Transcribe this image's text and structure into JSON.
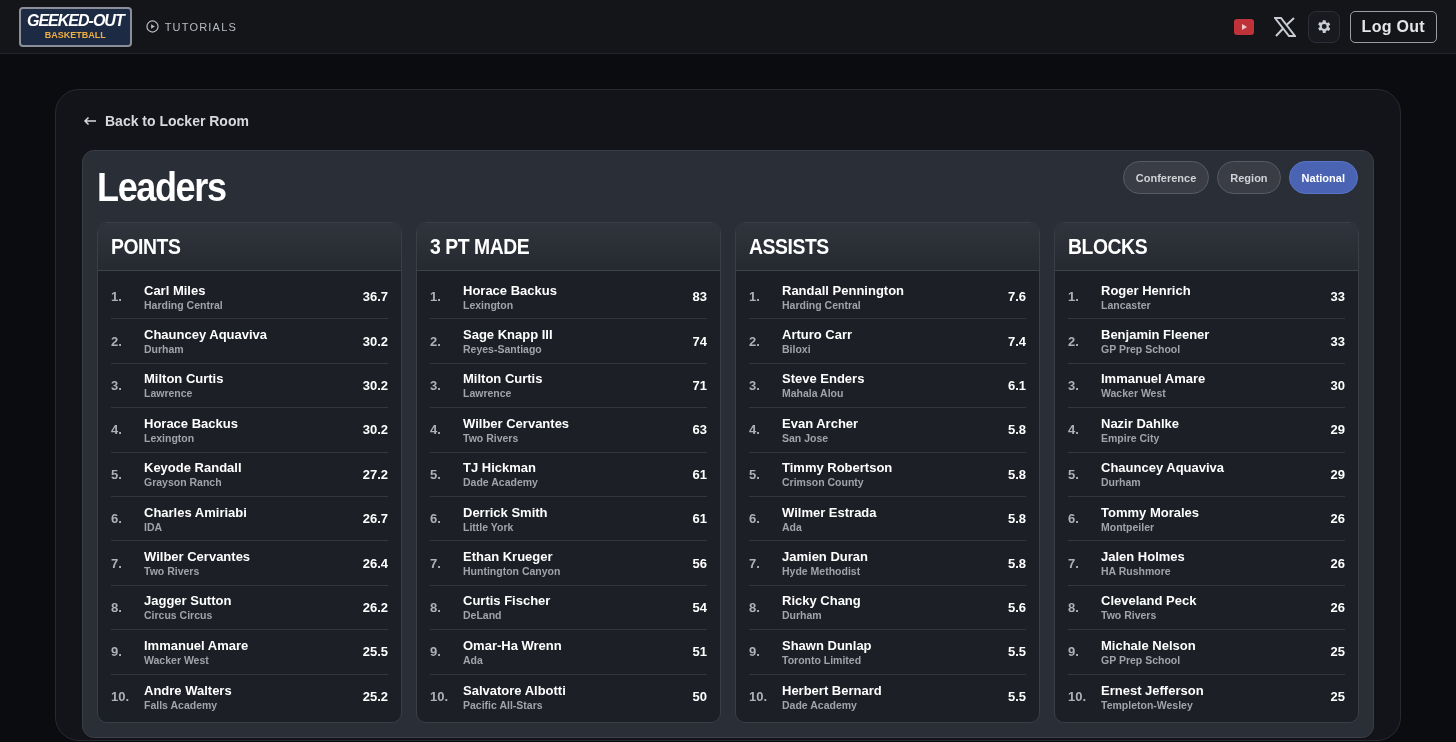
{
  "header": {
    "logo": {
      "title": "GEEKED-OUT",
      "subtitle": "BASKETBALL"
    },
    "tutorials": "TUTORIALS",
    "logout": "Log Out"
  },
  "back_link": "Back to Locker Room",
  "title": "Leaders",
  "scopes": [
    {
      "label": "Conference",
      "selected": false
    },
    {
      "label": "Region",
      "selected": false
    },
    {
      "label": "National",
      "selected": true
    }
  ],
  "categories": [
    {
      "title": "POINTS",
      "rows": [
        {
          "rank": "1.",
          "name": "Carl Miles",
          "school": "Harding Central",
          "value": "36.7"
        },
        {
          "rank": "2.",
          "name": "Chauncey Aquaviva",
          "school": "Durham",
          "value": "30.2"
        },
        {
          "rank": "3.",
          "name": "Milton Curtis",
          "school": "Lawrence",
          "value": "30.2"
        },
        {
          "rank": "4.",
          "name": "Horace Backus",
          "school": "Lexington",
          "value": "30.2"
        },
        {
          "rank": "5.",
          "name": "Keyode Randall",
          "school": "Grayson Ranch",
          "value": "27.2"
        },
        {
          "rank": "6.",
          "name": "Charles Amiriabi",
          "school": "IDA",
          "value": "26.7"
        },
        {
          "rank": "7.",
          "name": "Wilber Cervantes",
          "school": "Two Rivers",
          "value": "26.4"
        },
        {
          "rank": "8.",
          "name": "Jagger Sutton",
          "school": "Circus Circus",
          "value": "26.2"
        },
        {
          "rank": "9.",
          "name": "Immanuel Amare",
          "school": "Wacker West",
          "value": "25.5"
        },
        {
          "rank": "10.",
          "name": "Andre Walters",
          "school": "Falls Academy",
          "value": "25.2"
        }
      ]
    },
    {
      "title": "3 PT MADE",
      "rows": [
        {
          "rank": "1.",
          "name": "Horace Backus",
          "school": "Lexington",
          "value": "83"
        },
        {
          "rank": "2.",
          "name": "Sage Knapp III",
          "school": "Reyes-Santiago",
          "value": "74"
        },
        {
          "rank": "3.",
          "name": "Milton Curtis",
          "school": "Lawrence",
          "value": "71"
        },
        {
          "rank": "4.",
          "name": "Wilber Cervantes",
          "school": "Two Rivers",
          "value": "63"
        },
        {
          "rank": "5.",
          "name": "TJ Hickman",
          "school": "Dade Academy",
          "value": "61"
        },
        {
          "rank": "6.",
          "name": "Derrick Smith",
          "school": "Little York",
          "value": "61"
        },
        {
          "rank": "7.",
          "name": "Ethan Krueger",
          "school": "Huntington Canyon",
          "value": "56"
        },
        {
          "rank": "8.",
          "name": "Curtis Fischer",
          "school": "DeLand",
          "value": "54"
        },
        {
          "rank": "9.",
          "name": "Omar-Ha Wrenn",
          "school": "Ada",
          "value": "51"
        },
        {
          "rank": "10.",
          "name": "Salvatore Albotti",
          "school": "Pacific All-Stars",
          "value": "50"
        }
      ]
    },
    {
      "title": "ASSISTS",
      "rows": [
        {
          "rank": "1.",
          "name": "Randall Pennington",
          "school": "Harding Central",
          "value": "7.6"
        },
        {
          "rank": "2.",
          "name": "Arturo Carr",
          "school": "Biloxi",
          "value": "7.4"
        },
        {
          "rank": "3.",
          "name": "Steve Enders",
          "school": "Mahala Alou",
          "value": "6.1"
        },
        {
          "rank": "4.",
          "name": "Evan Archer",
          "school": "San Jose",
          "value": "5.8"
        },
        {
          "rank": "5.",
          "name": "Timmy Robertson",
          "school": "Crimson County",
          "value": "5.8"
        },
        {
          "rank": "6.",
          "name": "Wilmer Estrada",
          "school": "Ada",
          "value": "5.8"
        },
        {
          "rank": "7.",
          "name": "Jamien Duran",
          "school": "Hyde Methodist",
          "value": "5.8"
        },
        {
          "rank": "8.",
          "name": "Ricky Chang",
          "school": "Durham",
          "value": "5.6"
        },
        {
          "rank": "9.",
          "name": "Shawn Dunlap",
          "school": "Toronto Limited",
          "value": "5.5"
        },
        {
          "rank": "10.",
          "name": "Herbert Bernard",
          "school": "Dade Academy",
          "value": "5.5"
        }
      ]
    },
    {
      "title": "BLOCKS",
      "rows": [
        {
          "rank": "1.",
          "name": "Roger Henrich",
          "school": "Lancaster",
          "value": "33"
        },
        {
          "rank": "2.",
          "name": "Benjamin Fleener",
          "school": "GP Prep School",
          "value": "33"
        },
        {
          "rank": "3.",
          "name": "Immanuel Amare",
          "school": "Wacker West",
          "value": "30"
        },
        {
          "rank": "4.",
          "name": "Nazir Dahlke",
          "school": "Empire City",
          "value": "29"
        },
        {
          "rank": "5.",
          "name": "Chauncey Aquaviva",
          "school": "Durham",
          "value": "29"
        },
        {
          "rank": "6.",
          "name": "Tommy Morales",
          "school": "Montpeiler",
          "value": "26"
        },
        {
          "rank": "7.",
          "name": "Jalen Holmes",
          "school": "HA Rushmore",
          "value": "26"
        },
        {
          "rank": "8.",
          "name": "Cleveland Peck",
          "school": "Two Rivers",
          "value": "26"
        },
        {
          "rank": "9.",
          "name": "Michale Nelson",
          "school": "GP Prep School",
          "value": "25"
        },
        {
          "rank": "10.",
          "name": "Ernest Jefferson",
          "school": "Templeton-Wesley",
          "value": "25"
        }
      ]
    }
  ]
}
